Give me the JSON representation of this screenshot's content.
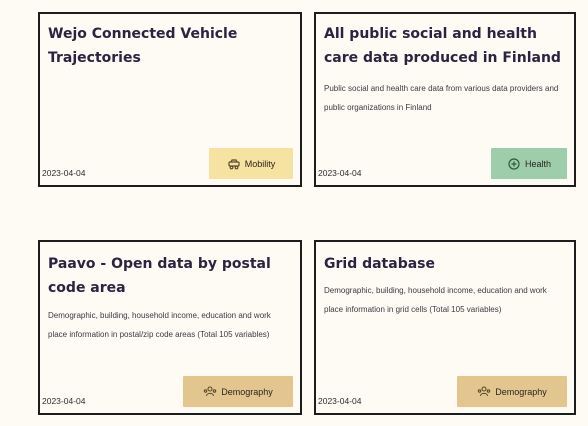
{
  "cards": [
    {
      "title": "Wejo Connected Vehicle Trajectories",
      "description": "",
      "date": "2023-04-04",
      "tag": {
        "label": "Mobility",
        "icon": "mobility-icon",
        "color": "#f6e2a1"
      }
    },
    {
      "title": "All public social and health care data produced in Finland",
      "description": "Public social and health care data from various data providers and public organizations in Finland",
      "date": "2023-04-04",
      "tag": {
        "label": "Health",
        "icon": "health-icon",
        "color": "#9dcdaa"
      }
    },
    {
      "title": "Paavo - Open data by postal code area",
      "description": "Demographic, building, household income, education and work place information in postal/zip code areas (Total 105 variables)",
      "date": "2023-04-04",
      "tag": {
        "label": "Demography",
        "icon": "demography-icon",
        "color": "#e3c68f"
      }
    },
    {
      "title": "Grid database",
      "description": "Demographic, building, household income, education and work place information in grid cells (Total 105 variables)",
      "date": "2023-04-04",
      "tag": {
        "label": "Demography",
        "icon": "demography-icon",
        "color": "#e3c68f"
      }
    }
  ]
}
